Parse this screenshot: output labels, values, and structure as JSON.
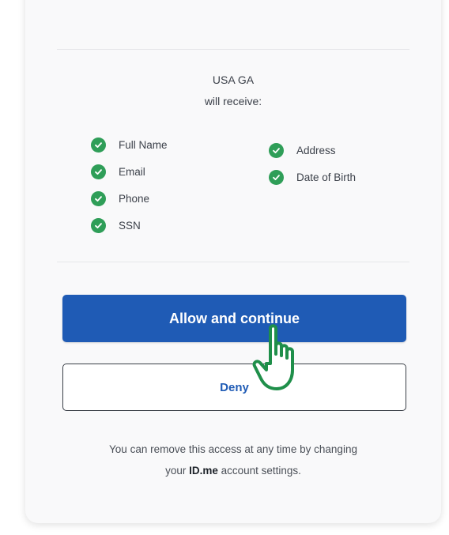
{
  "consent": {
    "org_name": "USA GA",
    "receive_text": "will receive:",
    "attributes_left": [
      "Full Name",
      "Email",
      "Phone",
      "SSN"
    ],
    "attributes_right": [
      "Address",
      "Date of Birth"
    ],
    "allow_label": "Allow and continue",
    "deny_label": "Deny",
    "footnote_line1": "You can remove this access at any time by changing",
    "footnote_prefix": "your",
    "footnote_brand": "ID.me",
    "footnote_suffix": "account settings."
  },
  "colors": {
    "primary": "#1f5bb5",
    "check": "#2f9e58",
    "hand_outline": "#1f8f4a"
  },
  "icons": {
    "attribute_status": "check-circle-icon",
    "pointer": "hand-pointer-icon"
  }
}
